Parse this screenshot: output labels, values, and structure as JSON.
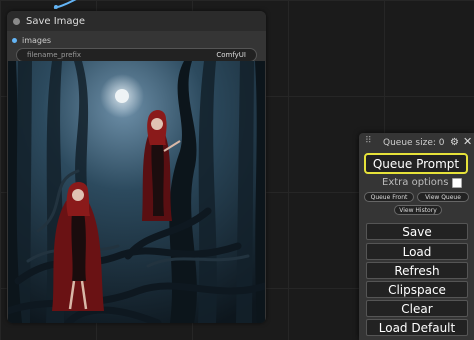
{
  "node": {
    "title": "Save Image",
    "output_label": "images",
    "widget": {
      "label": "filename_prefix",
      "value": "ComfyUI"
    }
  },
  "panel": {
    "drag_handle": "⠿",
    "queue_size": "Queue size: 0",
    "queue_prompt": "Queue Prompt",
    "extra_options": "Extra options",
    "extra_options_checked": false,
    "queue_front": "Queue Front",
    "view_queue": "View Queue",
    "view_history": "View History",
    "buttons": [
      "Save",
      "Load",
      "Refresh",
      "Clipspace",
      "Clear",
      "Load Default"
    ]
  },
  "colors": {
    "accent_highlight": "#e6e23a",
    "link_wire": "#64b5f6",
    "background": "#1b1b1b",
    "node": "#353535"
  },
  "icons": {
    "settings": "gear-icon",
    "close": "close-icon",
    "drag": "drag-handle-icon"
  }
}
